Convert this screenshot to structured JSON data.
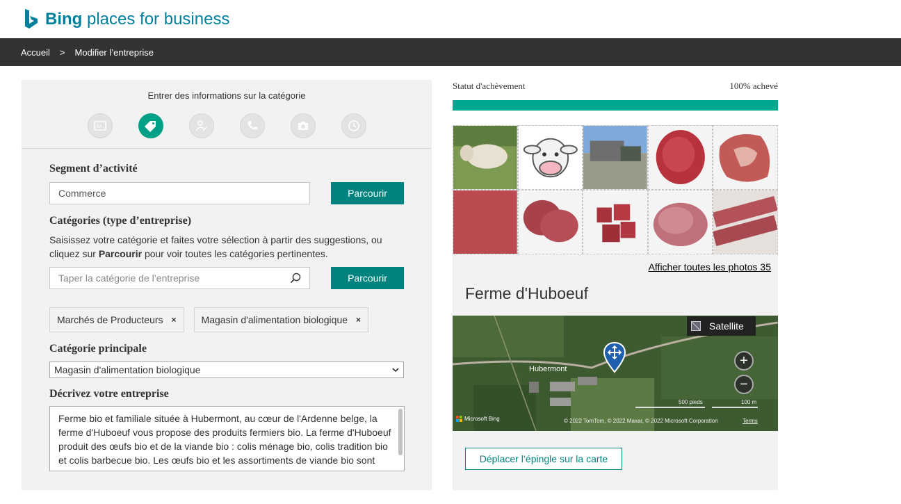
{
  "brand": {
    "name_bold": "Bing",
    "name_rest": " places for business"
  },
  "breadcrumb": {
    "home": "Accueil",
    "separator": ">",
    "current": "Modifier l’entreprise"
  },
  "steps": {
    "title": "Entrer des informations sur la catégorie",
    "items": [
      {
        "icon": "id-card-icon",
        "active": false
      },
      {
        "icon": "tag-icon",
        "active": true
      },
      {
        "icon": "person-edit-icon",
        "active": false
      },
      {
        "icon": "phone-icon",
        "active": false
      },
      {
        "icon": "camera-icon",
        "active": false
      },
      {
        "icon": "clock-icon",
        "active": false
      }
    ]
  },
  "segment": {
    "label": "Segment d’activité",
    "value": "Commerce",
    "browse": "Parcourir"
  },
  "categories": {
    "label": "Catégories (type d’entreprise)",
    "hint_part1": "Saisissez votre catégorie et faites votre sélection à partir des suggestions, ou cliquez sur ",
    "hint_bold": "Parcourir",
    "hint_part2": " pour voir toutes les catégories pertinentes.",
    "placeholder": "Taper la catégorie de l’entreprise",
    "browse": "Parcourir",
    "tags": [
      "Marchés de Producteurs",
      "Magasin d'alimentation biologique"
    ],
    "remove_glyph": "×"
  },
  "primary_category": {
    "label": "Catégorie principale",
    "value": "Magasin d'alimentation biologique"
  },
  "description": {
    "label": "Décrivez votre entreprise",
    "text": "Ferme bio et familiale située à Hubermont, au cœur de l'Ardenne belge, la ferme d'Huboeuf vous propose des produits fermiers bio. La ferme d'Huboeuf produit des œufs bio et de la viande bio : colis ménage bio, colis tradition bio et colis barbecue bio. Les œufs bio et les assortiments de viande bio sont disponibles à la vente sur internet ou à la ferme."
  },
  "status": {
    "label": "Statut d'achèvement",
    "value_text": "100% achevé",
    "percent": 100
  },
  "photos": {
    "all_link": "Afficher toutes les photos 35"
  },
  "business": {
    "name": "Ferme d'Huboeuf"
  },
  "map": {
    "satellite": "Satellite",
    "zoom_in": "+",
    "zoom_out": "−",
    "place": "Hubermont",
    "scale_ft": "500 pieds",
    "scale_m": "100 m",
    "attribution": "© 2022 TomTom, © 2022 Maxar, © 2022 Microsoft Corporation",
    "terms": "Terms",
    "provider": "Microsoft Bing"
  },
  "move_pin": "Déplacer l’épingle sur la carte",
  "colors": {
    "accent": "#00837e",
    "progress": "#00a88f",
    "brand": "#00809d"
  }
}
